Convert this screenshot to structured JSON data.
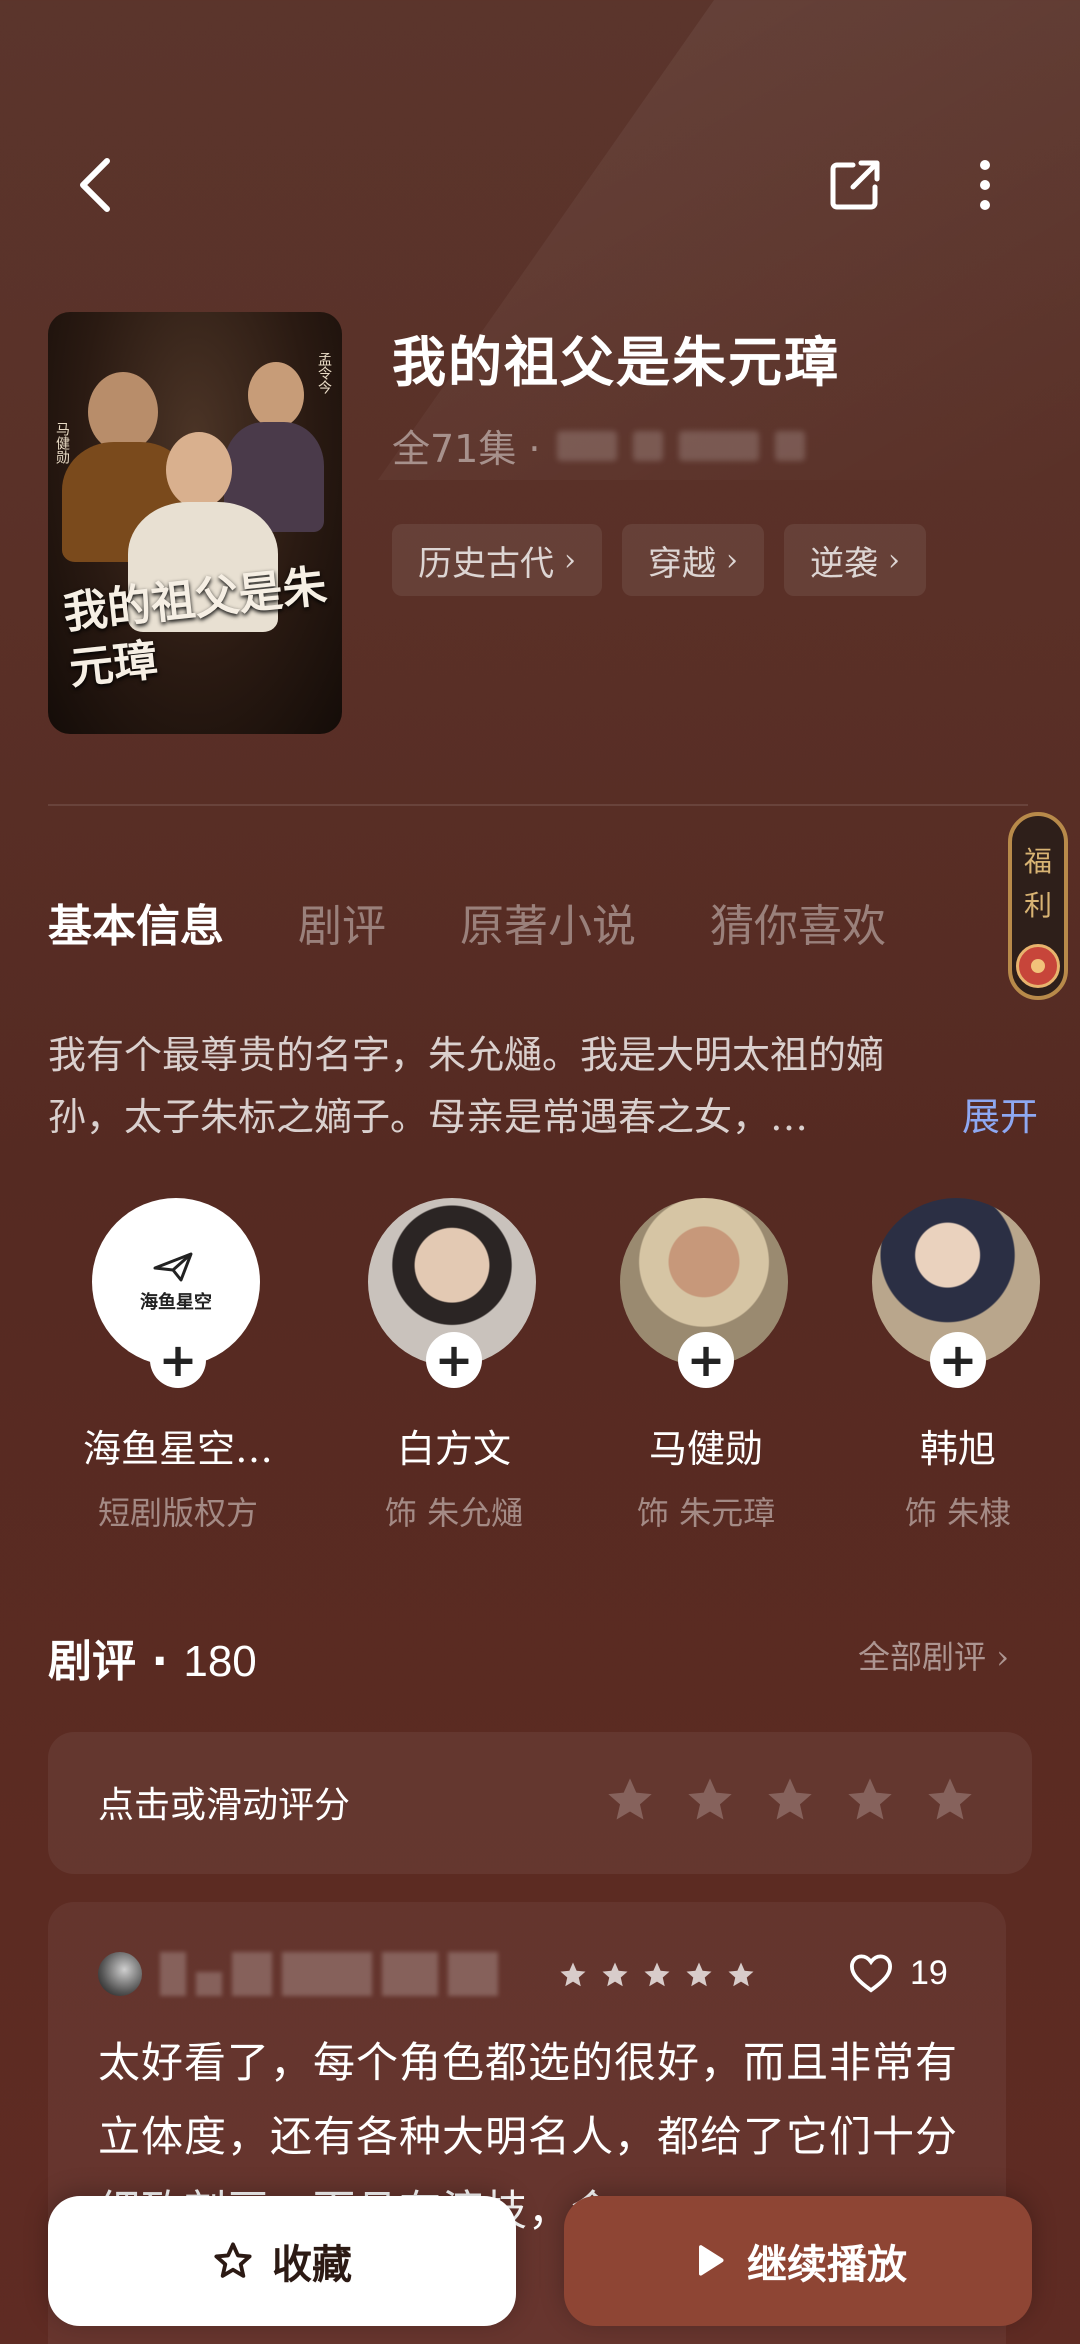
{
  "header": {
    "back_icon": "back-arrow-icon",
    "share_icon": "share-icon",
    "more_icon": "more-vertical-icon"
  },
  "show": {
    "title": "我的祖父是朱元璋",
    "episodes": "全71集 · ",
    "poster_title": "我的祖父是朱元璋",
    "tags": [
      {
        "label": "历史古代"
      },
      {
        "label": "穿越"
      },
      {
        "label": "逆袭"
      }
    ]
  },
  "tabs": [
    {
      "label": "基本信息"
    },
    {
      "label": "剧评"
    },
    {
      "label": "原著小说"
    },
    {
      "label": "猜你喜欢"
    }
  ],
  "welfare": {
    "label": "福利"
  },
  "synopsis": {
    "line1": "我有个最尊贵的名字，朱允熥。我是大明太祖的嫡",
    "line2": "孙，太子朱标之嫡子。母亲是常遇春之女，…",
    "expand": "展开"
  },
  "people": [
    {
      "name": "海鱼星空…",
      "role": "短剧版权方",
      "logo_text": "海鱼星空"
    },
    {
      "name": "白方文",
      "role": "饰 朱允熥"
    },
    {
      "name": "马健勋",
      "role": "饰 朱元璋"
    },
    {
      "name": "韩旭",
      "role": "饰 朱棣"
    }
  ],
  "reviews": {
    "title": "剧评",
    "count": "180",
    "all_label": "全部剧评",
    "rate_prompt": "点击或滑动评分",
    "comment": {
      "likes": "19",
      "stars": 5,
      "text": "太好看了，每个角色都选的很好，而且非常有立体度，还有各种大明名人，都给了它们十分细致刻画，而且有演技，令"
    }
  },
  "actions": {
    "collect": "收藏",
    "play": "继续播放"
  },
  "colors": {
    "background": "#5a3027",
    "play_button": "#8e4534",
    "expand_link": "#8ea8f2",
    "welfare_border": "#b88a4a"
  }
}
